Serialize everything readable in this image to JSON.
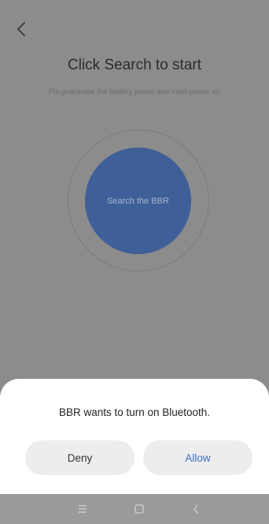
{
  "header": {
    "back_icon": "chevron-left-icon"
  },
  "main": {
    "title": "Click Search to start",
    "subtitle": "Pls guarantee the battery power and main power on",
    "search_button_label": "Search the BBR"
  },
  "dialog": {
    "message": "BBR wants to turn on Bluetooth.",
    "deny_label": "Deny",
    "allow_label": "Allow"
  },
  "nav_bar": {
    "icons": [
      "recents-icon",
      "home-icon",
      "back-icon"
    ]
  },
  "colors": {
    "dim_overlay": "#8c8c8c",
    "search_button": "#3e5f97",
    "allow_text": "#3f6fc7",
    "dialog_button_bg": "#ededed"
  }
}
